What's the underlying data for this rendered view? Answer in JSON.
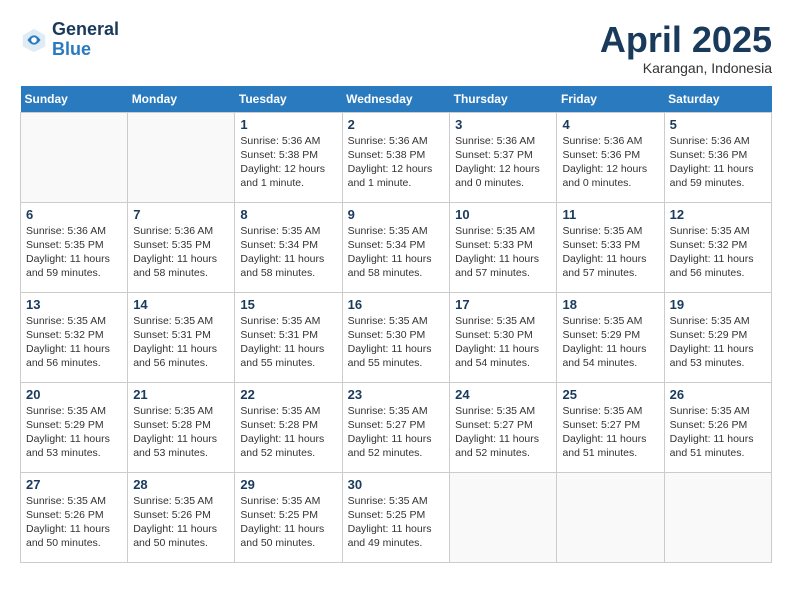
{
  "logo": {
    "line1": "General",
    "line2": "Blue"
  },
  "title": "April 2025",
  "subtitle": "Karangan, Indonesia",
  "header_days": [
    "Sunday",
    "Monday",
    "Tuesday",
    "Wednesday",
    "Thursday",
    "Friday",
    "Saturday"
  ],
  "weeks": [
    [
      {
        "day": "",
        "sunrise": "",
        "sunset": "",
        "daylight": ""
      },
      {
        "day": "",
        "sunrise": "",
        "sunset": "",
        "daylight": ""
      },
      {
        "day": "1",
        "sunrise": "Sunrise: 5:36 AM",
        "sunset": "Sunset: 5:38 PM",
        "daylight": "Daylight: 12 hours and 1 minute."
      },
      {
        "day": "2",
        "sunrise": "Sunrise: 5:36 AM",
        "sunset": "Sunset: 5:38 PM",
        "daylight": "Daylight: 12 hours and 1 minute."
      },
      {
        "day": "3",
        "sunrise": "Sunrise: 5:36 AM",
        "sunset": "Sunset: 5:37 PM",
        "daylight": "Daylight: 12 hours and 0 minutes."
      },
      {
        "day": "4",
        "sunrise": "Sunrise: 5:36 AM",
        "sunset": "Sunset: 5:36 PM",
        "daylight": "Daylight: 12 hours and 0 minutes."
      },
      {
        "day": "5",
        "sunrise": "Sunrise: 5:36 AM",
        "sunset": "Sunset: 5:36 PM",
        "daylight": "Daylight: 11 hours and 59 minutes."
      }
    ],
    [
      {
        "day": "6",
        "sunrise": "Sunrise: 5:36 AM",
        "sunset": "Sunset: 5:35 PM",
        "daylight": "Daylight: 11 hours and 59 minutes."
      },
      {
        "day": "7",
        "sunrise": "Sunrise: 5:36 AM",
        "sunset": "Sunset: 5:35 PM",
        "daylight": "Daylight: 11 hours and 58 minutes."
      },
      {
        "day": "8",
        "sunrise": "Sunrise: 5:35 AM",
        "sunset": "Sunset: 5:34 PM",
        "daylight": "Daylight: 11 hours and 58 minutes."
      },
      {
        "day": "9",
        "sunrise": "Sunrise: 5:35 AM",
        "sunset": "Sunset: 5:34 PM",
        "daylight": "Daylight: 11 hours and 58 minutes."
      },
      {
        "day": "10",
        "sunrise": "Sunrise: 5:35 AM",
        "sunset": "Sunset: 5:33 PM",
        "daylight": "Daylight: 11 hours and 57 minutes."
      },
      {
        "day": "11",
        "sunrise": "Sunrise: 5:35 AM",
        "sunset": "Sunset: 5:33 PM",
        "daylight": "Daylight: 11 hours and 57 minutes."
      },
      {
        "day": "12",
        "sunrise": "Sunrise: 5:35 AM",
        "sunset": "Sunset: 5:32 PM",
        "daylight": "Daylight: 11 hours and 56 minutes."
      }
    ],
    [
      {
        "day": "13",
        "sunrise": "Sunrise: 5:35 AM",
        "sunset": "Sunset: 5:32 PM",
        "daylight": "Daylight: 11 hours and 56 minutes."
      },
      {
        "day": "14",
        "sunrise": "Sunrise: 5:35 AM",
        "sunset": "Sunset: 5:31 PM",
        "daylight": "Daylight: 11 hours and 56 minutes."
      },
      {
        "day": "15",
        "sunrise": "Sunrise: 5:35 AM",
        "sunset": "Sunset: 5:31 PM",
        "daylight": "Daylight: 11 hours and 55 minutes."
      },
      {
        "day": "16",
        "sunrise": "Sunrise: 5:35 AM",
        "sunset": "Sunset: 5:30 PM",
        "daylight": "Daylight: 11 hours and 55 minutes."
      },
      {
        "day": "17",
        "sunrise": "Sunrise: 5:35 AM",
        "sunset": "Sunset: 5:30 PM",
        "daylight": "Daylight: 11 hours and 54 minutes."
      },
      {
        "day": "18",
        "sunrise": "Sunrise: 5:35 AM",
        "sunset": "Sunset: 5:29 PM",
        "daylight": "Daylight: 11 hours and 54 minutes."
      },
      {
        "day": "19",
        "sunrise": "Sunrise: 5:35 AM",
        "sunset": "Sunset: 5:29 PM",
        "daylight": "Daylight: 11 hours and 53 minutes."
      }
    ],
    [
      {
        "day": "20",
        "sunrise": "Sunrise: 5:35 AM",
        "sunset": "Sunset: 5:29 PM",
        "daylight": "Daylight: 11 hours and 53 minutes."
      },
      {
        "day": "21",
        "sunrise": "Sunrise: 5:35 AM",
        "sunset": "Sunset: 5:28 PM",
        "daylight": "Daylight: 11 hours and 53 minutes."
      },
      {
        "day": "22",
        "sunrise": "Sunrise: 5:35 AM",
        "sunset": "Sunset: 5:28 PM",
        "daylight": "Daylight: 11 hours and 52 minutes."
      },
      {
        "day": "23",
        "sunrise": "Sunrise: 5:35 AM",
        "sunset": "Sunset: 5:27 PM",
        "daylight": "Daylight: 11 hours and 52 minutes."
      },
      {
        "day": "24",
        "sunrise": "Sunrise: 5:35 AM",
        "sunset": "Sunset: 5:27 PM",
        "daylight": "Daylight: 11 hours and 52 minutes."
      },
      {
        "day": "25",
        "sunrise": "Sunrise: 5:35 AM",
        "sunset": "Sunset: 5:27 PM",
        "daylight": "Daylight: 11 hours and 51 minutes."
      },
      {
        "day": "26",
        "sunrise": "Sunrise: 5:35 AM",
        "sunset": "Sunset: 5:26 PM",
        "daylight": "Daylight: 11 hours and 51 minutes."
      }
    ],
    [
      {
        "day": "27",
        "sunrise": "Sunrise: 5:35 AM",
        "sunset": "Sunset: 5:26 PM",
        "daylight": "Daylight: 11 hours and 50 minutes."
      },
      {
        "day": "28",
        "sunrise": "Sunrise: 5:35 AM",
        "sunset": "Sunset: 5:26 PM",
        "daylight": "Daylight: 11 hours and 50 minutes."
      },
      {
        "day": "29",
        "sunrise": "Sunrise: 5:35 AM",
        "sunset": "Sunset: 5:25 PM",
        "daylight": "Daylight: 11 hours and 50 minutes."
      },
      {
        "day": "30",
        "sunrise": "Sunrise: 5:35 AM",
        "sunset": "Sunset: 5:25 PM",
        "daylight": "Daylight: 11 hours and 49 minutes."
      },
      {
        "day": "",
        "sunrise": "",
        "sunset": "",
        "daylight": ""
      },
      {
        "day": "",
        "sunrise": "",
        "sunset": "",
        "daylight": ""
      },
      {
        "day": "",
        "sunrise": "",
        "sunset": "",
        "daylight": ""
      }
    ]
  ]
}
